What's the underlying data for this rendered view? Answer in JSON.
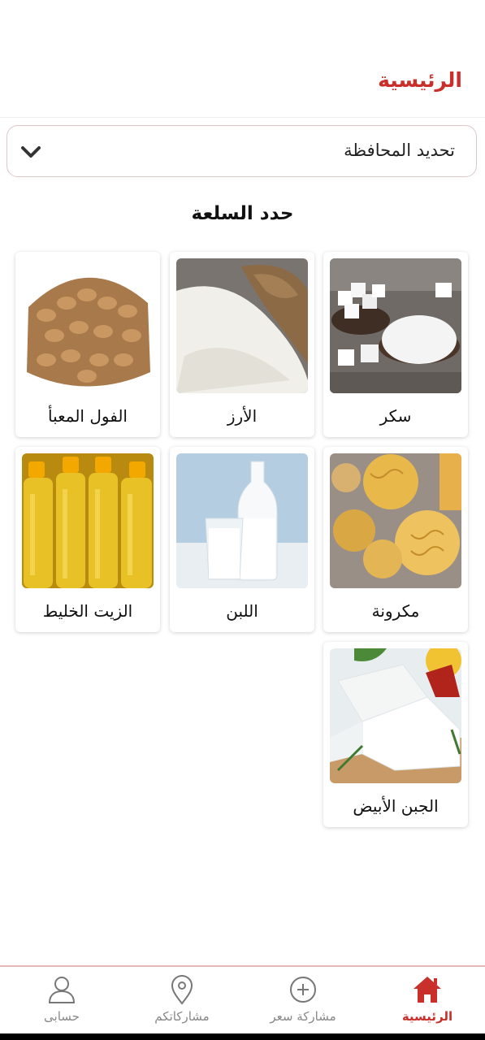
{
  "header": {
    "title": "الرئيسية"
  },
  "governorate_select": {
    "label": "تحديد المحافظة",
    "icon": "chevron-down-icon"
  },
  "section": {
    "title": "حدد السلعة"
  },
  "products": [
    {
      "name": "سكر"
    },
    {
      "name": "الأرز"
    },
    {
      "name": "الفول المعبأ"
    },
    {
      "name": "مكرونة"
    },
    {
      "name": "اللبن"
    },
    {
      "name": "الزيت الخليط"
    },
    {
      "name": "الجبن الأبيض"
    }
  ],
  "bottom_nav": {
    "items": [
      {
        "label": "الرئيسية",
        "icon": "home-icon",
        "active": true
      },
      {
        "label": "مشاركة سعر",
        "icon": "plus-circle-icon"
      },
      {
        "label": "مشاركاتكم",
        "icon": "location-pin-icon"
      },
      {
        "label": "حسابى",
        "icon": "user-icon"
      }
    ]
  },
  "colors": {
    "accent": "#c9302c"
  }
}
